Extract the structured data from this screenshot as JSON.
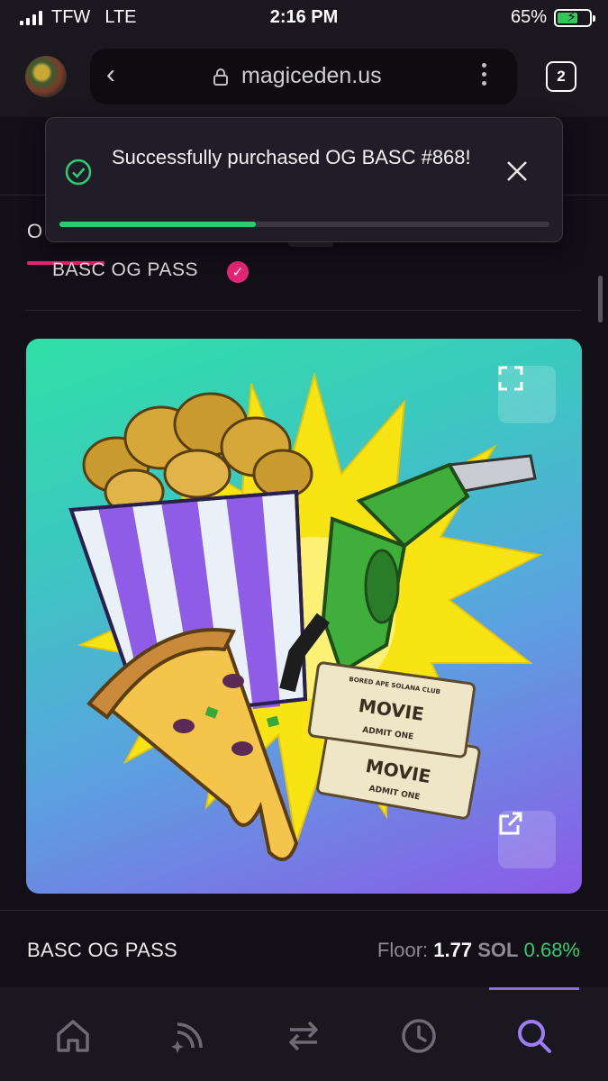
{
  "status_bar": {
    "carrier": "TFW",
    "network": "LTE",
    "time": "2:16 PM",
    "battery": "65%",
    "battery_level": 0.65
  },
  "browser": {
    "url": "magiceden.us",
    "tab_count": "2"
  },
  "page": {
    "tab_partial": "O",
    "collection_title": "BASC OG PASS",
    "nft_image": {
      "ticket_header": "BORED APE SOLANA CLUB",
      "ticket_title": "MOVIE",
      "ticket_footer": "ADMIT ONE"
    },
    "footer": {
      "name": "BASC OG PASS",
      "floor_label": "Floor:",
      "floor_value": "1.77",
      "currency": "SOL",
      "change": "0.68%"
    }
  },
  "toast": {
    "message": "Successfully purchased OG BASC #868!",
    "progress": 0.4
  },
  "bottom_nav": {
    "items": [
      {
        "name": "home",
        "icon": "home-icon"
      },
      {
        "name": "feed",
        "icon": "feed-icon"
      },
      {
        "name": "swap",
        "icon": "swap-icon"
      },
      {
        "name": "history",
        "icon": "clock-icon"
      },
      {
        "name": "search",
        "icon": "search-icon"
      }
    ],
    "active": "search"
  },
  "colors": {
    "accent_pink": "#e42575",
    "success_green": "#2ecc71",
    "nav_active": "#8b6cf2"
  }
}
